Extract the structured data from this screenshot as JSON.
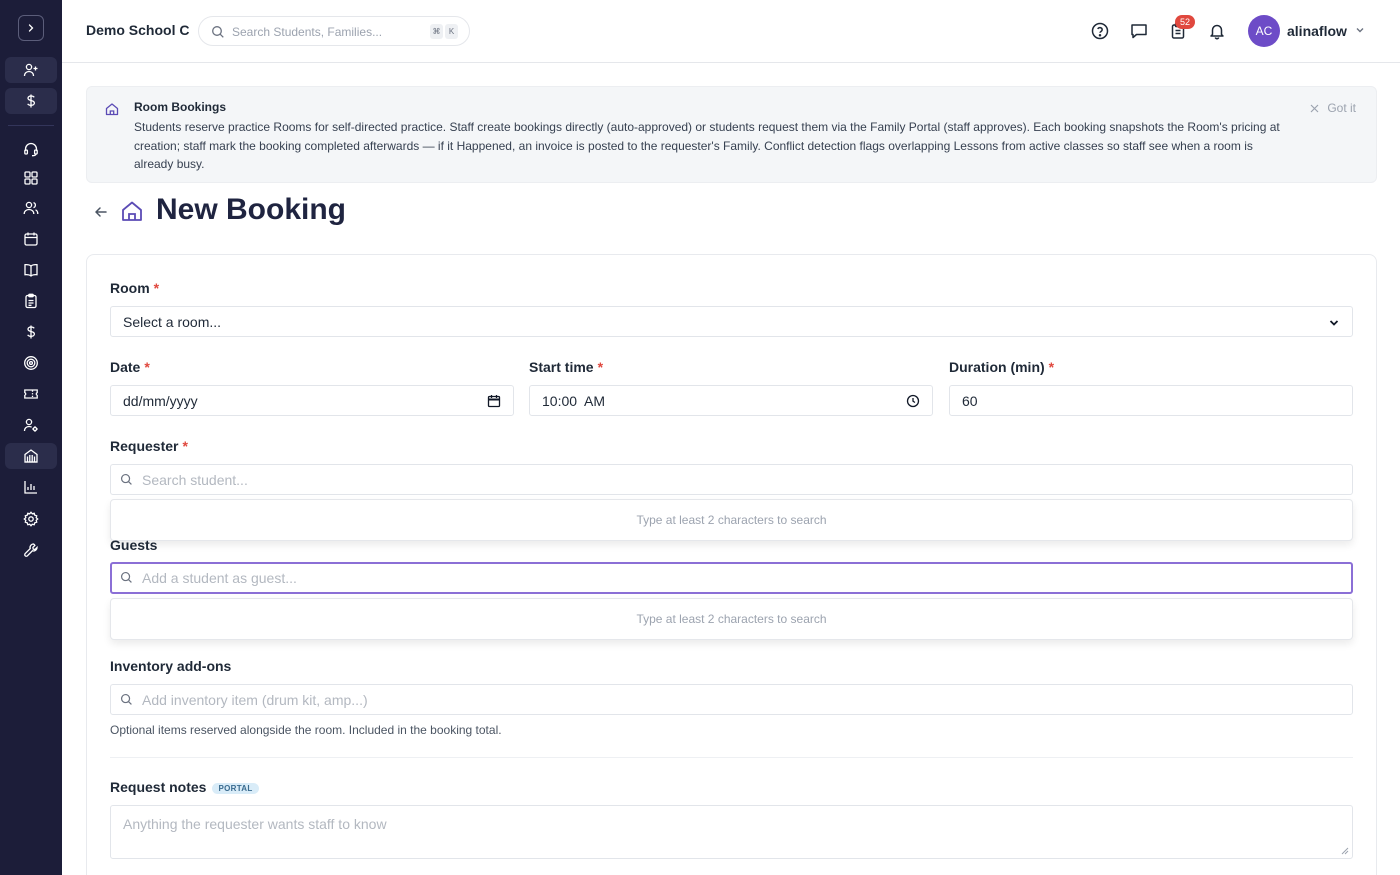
{
  "header": {
    "school_name": "Demo School C",
    "search_placeholder": "Search Students, Families...",
    "shortcut_keys": [
      "⌘",
      "K"
    ],
    "notification_badge": "52",
    "user": {
      "initials": "AC",
      "name": "alinaflow"
    }
  },
  "sidebar": {
    "items": [
      {
        "icon": "user-plus-icon",
        "highlight": true
      },
      {
        "icon": "dollar-icon",
        "highlight": true
      },
      {
        "icon": "headset-icon"
      },
      {
        "icon": "dashboard-icon"
      },
      {
        "icon": "users-icon"
      },
      {
        "icon": "calendar-icon"
      },
      {
        "icon": "book-icon"
      },
      {
        "icon": "clipboard-icon"
      },
      {
        "icon": "dollar-icon"
      },
      {
        "icon": "target-icon"
      },
      {
        "icon": "ticket-icon"
      },
      {
        "icon": "user-settings-icon"
      },
      {
        "icon": "building-icon",
        "active": true
      },
      {
        "icon": "chart-icon"
      },
      {
        "icon": "gear-icon"
      },
      {
        "icon": "wrench-icon"
      }
    ]
  },
  "banner": {
    "title": "Room Bookings",
    "text": "Students reserve practice Rooms for self-directed practice. Staff create bookings directly (auto-approved) or students request them via the Family Portal (staff approves). Each booking snapshots the Room's pricing at creation; staff mark the booking completed afterwards — if it Happened, an invoice is posted to the requester's Family. Conflict detection flags overlapping Lessons from active classes so staff see when a room is already busy.",
    "dismiss_label": "Got it"
  },
  "page": {
    "title": "New Booking"
  },
  "form": {
    "room": {
      "label": "Room",
      "required": "*",
      "value": "Select a room..."
    },
    "date": {
      "label": "Date",
      "required": "*",
      "value": "dd/mm/yyyy"
    },
    "start_time": {
      "label": "Start time",
      "required": "*",
      "value": "10:00  AM"
    },
    "duration": {
      "label": "Duration (min)",
      "required": "*",
      "value": "60"
    },
    "requester": {
      "label": "Requester",
      "required": "*",
      "placeholder": "Search student...",
      "dropdown_hint": "Type at least 2 characters to search"
    },
    "guests": {
      "label": "Guests",
      "placeholder": "Add a student as guest...",
      "dropdown_hint": "Type at least 2 characters to search"
    },
    "inventory": {
      "label": "Inventory add-ons",
      "placeholder": "Add inventory item (drum kit, amp...)",
      "hint": "Optional items reserved alongside the room. Included in the booking total."
    },
    "notes": {
      "label": "Request notes",
      "badge": "PORTAL",
      "placeholder": "Anything the requester wants staff to know"
    }
  },
  "colors": {
    "sidebar_bg": "#1c1d39",
    "accent": "#6d4cc7",
    "required": "#e0483e",
    "badge": "#e0483e"
  }
}
